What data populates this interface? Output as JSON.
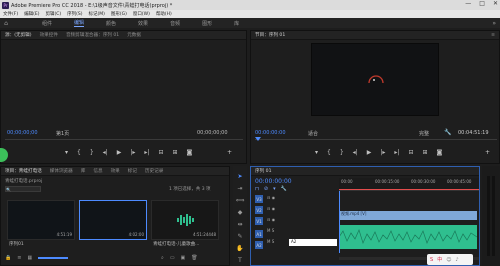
{
  "titlebar": {
    "app_glyph": "Pr",
    "title": "Adobe Premiere Pro CC 2018 - E:\\1级声音文件\\青蛙打电话(prproj) *",
    "min": "—",
    "max": "□",
    "close": "✕"
  },
  "menu": [
    "文件(F)",
    "编辑(E)",
    "剪辑(C)",
    "序列(S)",
    "标记(M)",
    "图形(G)",
    "窗口(W)",
    "帮助(H)"
  ],
  "workspaces": {
    "home_icon": "⌂",
    "items": [
      {
        "label": "组件",
        "active": false
      },
      {
        "label": "编辑",
        "active": true
      },
      {
        "label": "颜色",
        "active": false
      },
      {
        "label": "效果",
        "active": false
      },
      {
        "label": "音频",
        "active": false
      },
      {
        "label": "图形",
        "active": false
      },
      {
        "label": "库",
        "active": false
      }
    ],
    "more": "»"
  },
  "source_panel": {
    "tabs": [
      "源：(无剪辑)",
      "效果控件",
      "音频剪辑混合器：序列 01",
      "元数据"
    ],
    "timecode_left": "00;00;00;00",
    "fit": "第1页",
    "timecode_right": "00;00;00;00"
  },
  "program_panel": {
    "tab": "节目：序列 01",
    "timecode_left": "00:00:00:00",
    "fit": "适合",
    "quality": "完整",
    "timecode_right": "00:04:51:19"
  },
  "project_panel": {
    "tabs": [
      "项目：青蛙打电话",
      "媒体浏览器",
      "库",
      "信息",
      "效果",
      "标记",
      "历史记录"
    ],
    "file_name": "青蛙打电话.prproj",
    "item_count": "1 项已选择，共 3 项",
    "search_icon": "🔍",
    "items": [
      {
        "name": "序列01",
        "duration": "4:51:19",
        "type": "video"
      },
      {
        "name": "",
        "duration": "4:02:00",
        "type": "video"
      },
      {
        "name": "青蛙打电话-儿童歌曲...",
        "duration": "4:51:24448",
        "type": "audio"
      }
    ]
  },
  "timeline": {
    "tab": "序列 01",
    "timecode": "00:00:00:00",
    "ruler_marks": [
      "00:00",
      "00:00:15:00",
      "00:00:30:00",
      "00:00:45:00"
    ],
    "tracks": [
      {
        "label": "V3",
        "type": "video"
      },
      {
        "label": "V2",
        "type": "video"
      },
      {
        "label": "V1",
        "type": "video"
      },
      {
        "label": "A1",
        "type": "audio"
      },
      {
        "label": "A2",
        "type": "audio"
      },
      {
        "label": "A3",
        "type": "audio"
      }
    ],
    "video_clip": "视频.mp4 [V]",
    "audio_clip": "",
    "edit_field": "A2"
  },
  "colors": {
    "accent": "#4d8bff",
    "video_clip": "#7fa8d8",
    "audio_clip": "#2fbf8f",
    "playhead": "#e44d4d"
  },
  "tools": [
    "select-tool",
    "track-select-tool",
    "ripple-edit-tool",
    "razor-tool",
    "slip-tool",
    "pen-tool",
    "hand-tool",
    "type-tool"
  ],
  "tray": {
    "badge": "中"
  }
}
